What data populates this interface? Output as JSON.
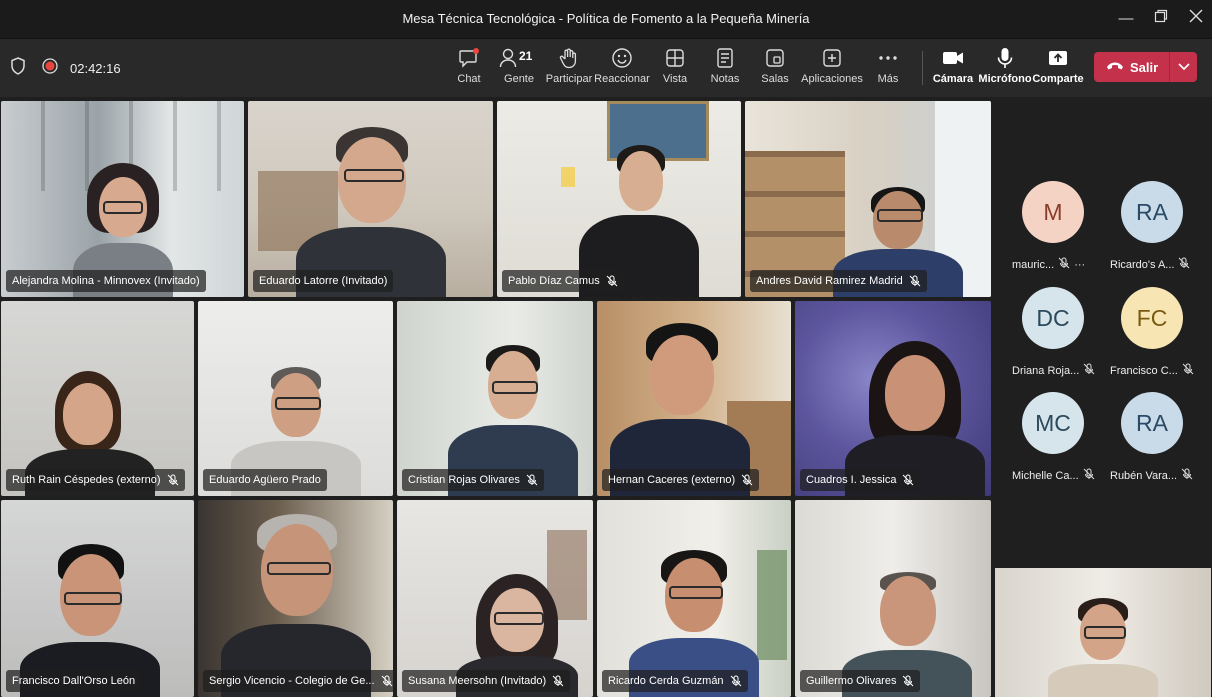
{
  "window": {
    "title": "Mesa Técnica Tecnológica - Política de Fomento a la Pequeña Minería"
  },
  "toolbar": {
    "timer": "02:42:16",
    "buttons": [
      {
        "label": "Chat",
        "icon": "chat-icon"
      },
      {
        "label": "Gente",
        "icon": "people-icon",
        "count": "21"
      },
      {
        "label": "Participar",
        "icon": "raise-hand-icon"
      },
      {
        "label": "Reaccionar",
        "icon": "smiley-icon"
      },
      {
        "label": "Vista",
        "icon": "view-icon"
      },
      {
        "label": "Notas",
        "icon": "notes-icon"
      },
      {
        "label": "Salas",
        "icon": "rooms-icon"
      },
      {
        "label": "Aplicaciones",
        "icon": "add-apps-icon"
      },
      {
        "label": "Más",
        "icon": "more-icon"
      },
      {
        "label": "Cámara",
        "icon": "camera-icon"
      },
      {
        "label": "Micrófono",
        "icon": "microphone-icon"
      },
      {
        "label": "Comparte",
        "icon": "share-icon"
      }
    ],
    "leave_label": "Salir"
  },
  "participants": [
    {
      "name": "Alejandra Molina - Minnovex (Invitado)",
      "muted": false
    },
    {
      "name": "Eduardo Latorre (Invitado)",
      "muted": false
    },
    {
      "name": "Pablo Díaz Camus",
      "muted": true
    },
    {
      "name": "Andres David Ramirez Madrid",
      "muted": true
    },
    {
      "name": "Ruth Rain Céspedes (externo)",
      "muted": true
    },
    {
      "name": "Eduardo Agüero Prado",
      "muted": false
    },
    {
      "name": "Cristian Rojas Olivares",
      "muted": true
    },
    {
      "name": "Hernan Caceres (externo)",
      "muted": true
    },
    {
      "name": "Cuadros I. Jessica",
      "muted": true
    },
    {
      "name": "Francisco Dall'Orso León",
      "muted": false
    },
    {
      "name": "Sergio Vicencio - Colegio de Ge...",
      "muted": true
    },
    {
      "name": "Susana Meersohn (Invitado)",
      "muted": true
    },
    {
      "name": "Ricardo Cerda Guzmán",
      "muted": true
    },
    {
      "name": "Guillermo Olivares",
      "muted": true
    }
  ],
  "avatars": [
    {
      "initials": "M",
      "name": "mauric...",
      "color": "#f5d3c4",
      "more": "···"
    },
    {
      "initials": "RA",
      "name": "Ricardo's A...",
      "color": "#c9dbe8"
    },
    {
      "initials": "DC",
      "name": "Driana Roja...",
      "color": "#d6e4ec"
    },
    {
      "initials": "FC",
      "name": "Francisco C...",
      "color": "#f7e6b3"
    },
    {
      "initials": "MC",
      "name": "Michelle Ca...",
      "color": "#d6e4ec"
    },
    {
      "initials": "RA",
      "name": "Rubén Vara...",
      "color": "#c9dbe8"
    }
  ],
  "colors": {
    "accent_red": "#c4314b",
    "record": "#e8463d"
  }
}
